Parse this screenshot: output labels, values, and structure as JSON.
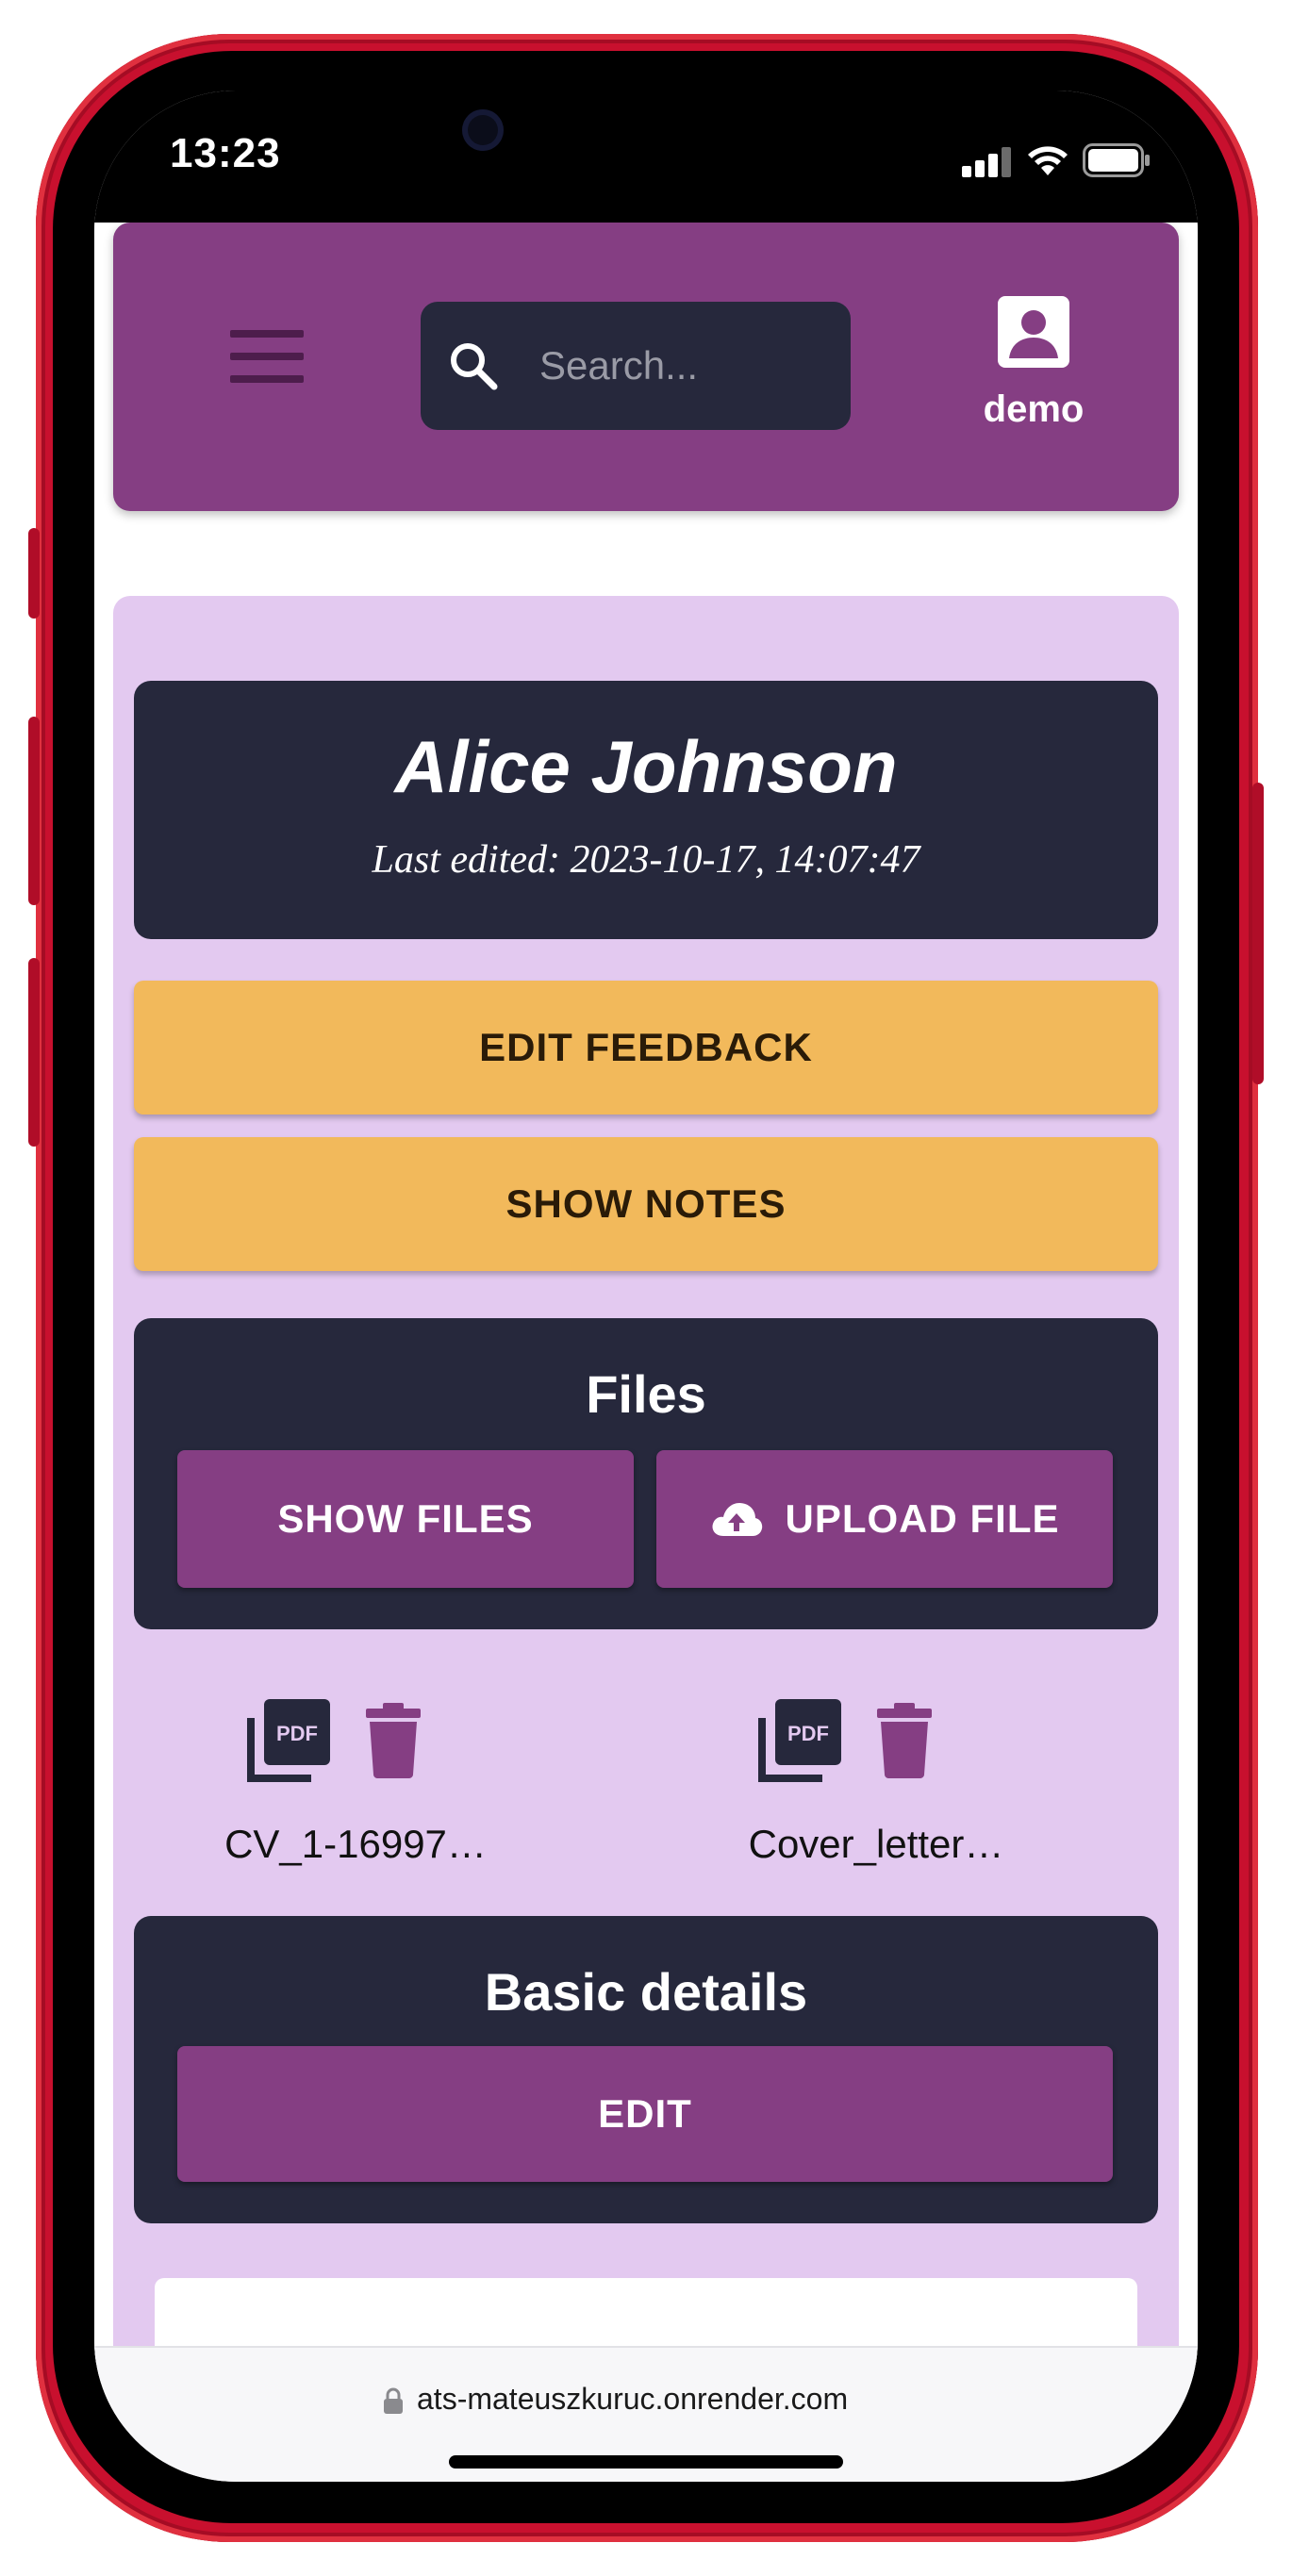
{
  "status_bar": {
    "time": "13:23"
  },
  "header": {
    "search_placeholder": "Search...",
    "username": "demo"
  },
  "candidate": {
    "name": "Alice Johnson",
    "last_edited": "Last edited: 2023-10-17, 14:07:47"
  },
  "actions": {
    "edit_feedback": "EDIT FEEDBACK",
    "show_notes": "SHOW NOTES"
  },
  "files": {
    "title": "Files",
    "show_files": "SHOW FILES",
    "upload_file": "UPLOAD FILE",
    "items": [
      {
        "name": "CV_1-16997…"
      },
      {
        "name": "Cover_letter…"
      }
    ]
  },
  "basic_details": {
    "title": "Basic details",
    "edit": "EDIT"
  },
  "browser": {
    "url": "ats-mateuszkuruc.onrender.com"
  },
  "colors": {
    "primary": "#853e83",
    "dark": "#26283c",
    "accent": "#f2b95b",
    "panel": "#e3c9f0",
    "frame": "#c8102e"
  }
}
